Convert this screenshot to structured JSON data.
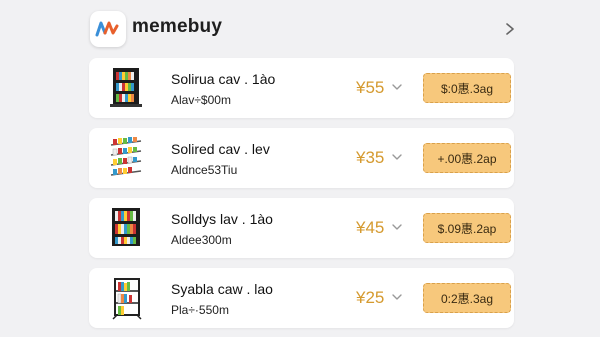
{
  "header": {
    "app_name": "memebuy",
    "logo_icon": "memebuy-logo-icon",
    "more_icon": "chevron-right-icon"
  },
  "colors": {
    "price": "#d59a2f",
    "coupon_bg": "#f7c87c",
    "page_bg": "#f1f1f3"
  },
  "products": [
    {
      "name": "Solirua cav . 1ào",
      "sub": "Alav÷$00m",
      "price": "¥55",
      "coupon": "$:0惠.3ag",
      "thumb_icon": "bookshelf-icon"
    },
    {
      "name": "Solired cav . lev",
      "sub": "Aldnce53Tiu",
      "price": "¥35",
      "coupon": "+.00惠.2ap",
      "thumb_icon": "shelving-rack-icon"
    },
    {
      "name": "Solldys lav . 1ào",
      "sub": "Aldee300m",
      "price": "¥45",
      "coupon": "$.09惠.2ap",
      "thumb_icon": "bookshelf-icon"
    },
    {
      "name": "Syabla caw . lao",
      "sub": "Pla÷·550m",
      "price": "¥25",
      "coupon": "0:2惠.3ag",
      "thumb_icon": "bookcase-icon"
    }
  ]
}
